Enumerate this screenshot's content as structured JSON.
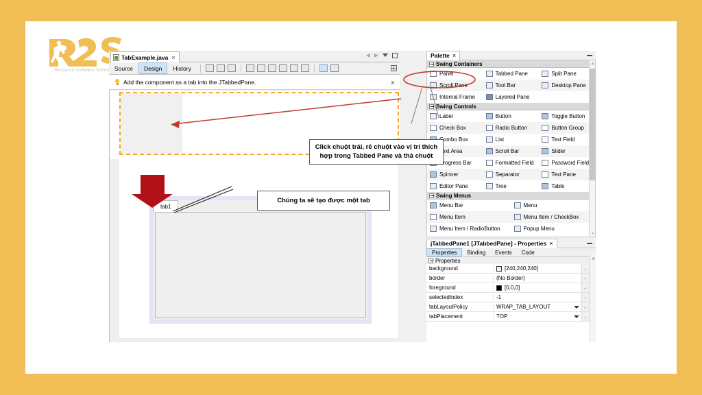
{
  "logo": {
    "name": "R2S",
    "tagline": "Resource Software Solution"
  },
  "editor": {
    "file_tab": {
      "label": "TabExample.java",
      "close": "×",
      "icon": "java-file-icon"
    },
    "view_tabs": [
      {
        "label": "Source",
        "selected": false
      },
      {
        "label": "Design",
        "selected": true
      },
      {
        "label": "History",
        "selected": false
      }
    ],
    "hint": {
      "text": "Add the component as a tab into the JTabbedPane.",
      "close": "x",
      "icon": "lightbulb-icon"
    },
    "window_controls": [
      "prev-arrow",
      "next-arrow",
      "dropdown-caret",
      "maximize-box"
    ],
    "toolbar_icons": [
      "selection-mode-icon",
      "connection-mode-icon",
      "preview-design-icon",
      "align-left-icon",
      "align-right-icon",
      "align-center-icon",
      "align-top-icon",
      "align-bottom-icon",
      "center-horizontally-icon",
      "resize-width-icon",
      "resize-height-icon",
      "grid-toggle-icon"
    ]
  },
  "canvas": {
    "jtabbedpane": {
      "tab_label": "tab1"
    },
    "drop_zone_label": "drop-target"
  },
  "callouts": {
    "one": "Click chuột trái, rê chuột vào vị trí thích hợp trong Tabbed Pane và thả chuột",
    "two": "Chúng ta sẽ tạo được một tab"
  },
  "palette": {
    "title": "Palette",
    "close": "×",
    "groups": [
      {
        "name": "Swing Containers",
        "columns": 3,
        "items": [
          {
            "label": "Panel",
            "icon": "panel-icon",
            "highlighted": true
          },
          {
            "label": "Tabbed Pane",
            "icon": "tabbed-pane-icon"
          },
          {
            "label": "Split Pane",
            "icon": "split-pane-icon"
          },
          {
            "label": "Scroll Pane",
            "icon": "scroll-pane-icon"
          },
          {
            "label": "Tool Bar",
            "icon": "tool-bar-icon"
          },
          {
            "label": "Desktop Pane",
            "icon": "desktop-pane-icon"
          },
          {
            "label": "Internal Frame",
            "icon": "internal-frame-icon"
          },
          {
            "label": "Layered Pane",
            "icon": "layered-pane-icon"
          },
          {
            "label": "",
            "icon": ""
          }
        ]
      },
      {
        "name": "Swing Controls",
        "columns": 3,
        "items": [
          {
            "label": "Label",
            "icon": "label-icon"
          },
          {
            "label": "Button",
            "icon": "button-icon"
          },
          {
            "label": "Toggle Button",
            "icon": "toggle-button-icon"
          },
          {
            "label": "Check Box",
            "icon": "check-box-icon"
          },
          {
            "label": "Radio Button",
            "icon": "radio-button-icon"
          },
          {
            "label": "Button Group",
            "icon": "button-group-icon"
          },
          {
            "label": "Combo Box",
            "icon": "combo-box-icon"
          },
          {
            "label": "List",
            "icon": "list-icon"
          },
          {
            "label": "Text Field",
            "icon": "text-field-icon"
          },
          {
            "label": "Text Area",
            "icon": "text-area-icon"
          },
          {
            "label": "Scroll Bar",
            "icon": "scroll-bar-icon"
          },
          {
            "label": "Slider",
            "icon": "slider-icon"
          },
          {
            "label": "Progress Bar",
            "icon": "progress-bar-icon"
          },
          {
            "label": "Formatted Field",
            "icon": "formatted-field-icon"
          },
          {
            "label": "Password Field",
            "icon": "password-field-icon"
          },
          {
            "label": "Spinner",
            "icon": "spinner-icon"
          },
          {
            "label": "Separator",
            "icon": "separator-icon"
          },
          {
            "label": "Text Pane",
            "icon": "text-pane-icon"
          },
          {
            "label": "Editor Pane",
            "icon": "editor-pane-icon"
          },
          {
            "label": "Tree",
            "icon": "tree-icon"
          },
          {
            "label": "Table",
            "icon": "table-icon"
          }
        ]
      },
      {
        "name": "Swing Menus",
        "columns": 2,
        "items": [
          {
            "label": "Menu Bar",
            "icon": "menu-bar-icon"
          },
          {
            "label": "Menu",
            "icon": "menu-icon"
          },
          {
            "label": "Menu Item",
            "icon": "menu-item-icon"
          },
          {
            "label": "Menu Item / CheckBox",
            "icon": "menu-item-checkbox-icon"
          },
          {
            "label": "Menu Item / RadioButton",
            "icon": "menu-item-radiobutton-icon"
          },
          {
            "label": "Popup Menu",
            "icon": "popup-menu-icon"
          }
        ]
      }
    ],
    "scroll_up": "ʌ",
    "scroll_down": "⌄"
  },
  "properties": {
    "title": "jTabbedPane1 [JTabbedPane] - Properties",
    "close": "×",
    "tabs": [
      {
        "label": "Properties",
        "selected": true
      },
      {
        "label": "Binding",
        "selected": false
      },
      {
        "label": "Events",
        "selected": false
      },
      {
        "label": "Code",
        "selected": false
      }
    ],
    "section": "Properties",
    "rows": [
      {
        "key": "background",
        "value": "[240,240,240]",
        "swatch": "#F0F0F0",
        "dropdown": false
      },
      {
        "key": "border",
        "value": "(No Border)",
        "swatch": null,
        "dropdown": false
      },
      {
        "key": "foreground",
        "value": "[0,0,0]",
        "swatch": "#000000",
        "dropdown": false
      },
      {
        "key": "selectedIndex",
        "value": "-1",
        "swatch": null,
        "dropdown": false
      },
      {
        "key": "tabLayoutPolicy",
        "value": "WRAP_TAB_LAYOUT",
        "swatch": null,
        "dropdown": true
      },
      {
        "key": "tabPlacement",
        "value": "TOP",
        "swatch": null,
        "dropdown": true
      }
    ],
    "ellipsis": "...",
    "scroll_up": "ʌ"
  },
  "colors": {
    "frame": "#F0BE54",
    "accent_red": "#B01217",
    "annotation_red": "#C0392B",
    "drop_border": "#F5A623",
    "selected_tab": "#CFE3F7"
  }
}
